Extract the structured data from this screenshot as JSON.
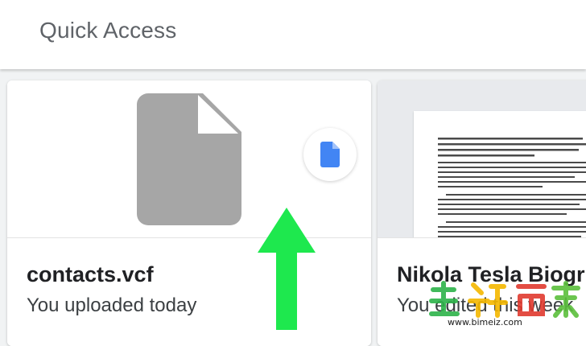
{
  "header": {
    "title": "Quick Access"
  },
  "files": [
    {
      "name": "contacts.vcf",
      "subtitle": "You uploaded today",
      "icon": "generic-file-icon",
      "badge_icon": "google-docs-icon"
    },
    {
      "name": "Nikola Tesla Biogr",
      "subtitle": "You edited this week",
      "icon": "document-preview"
    }
  ],
  "watermark": {
    "url": "www.bimeiz.com"
  },
  "colors": {
    "file_icon_gray": "#a6a6a6",
    "docs_blue": "#4285f4",
    "arrow_green": "#1ee84e"
  }
}
